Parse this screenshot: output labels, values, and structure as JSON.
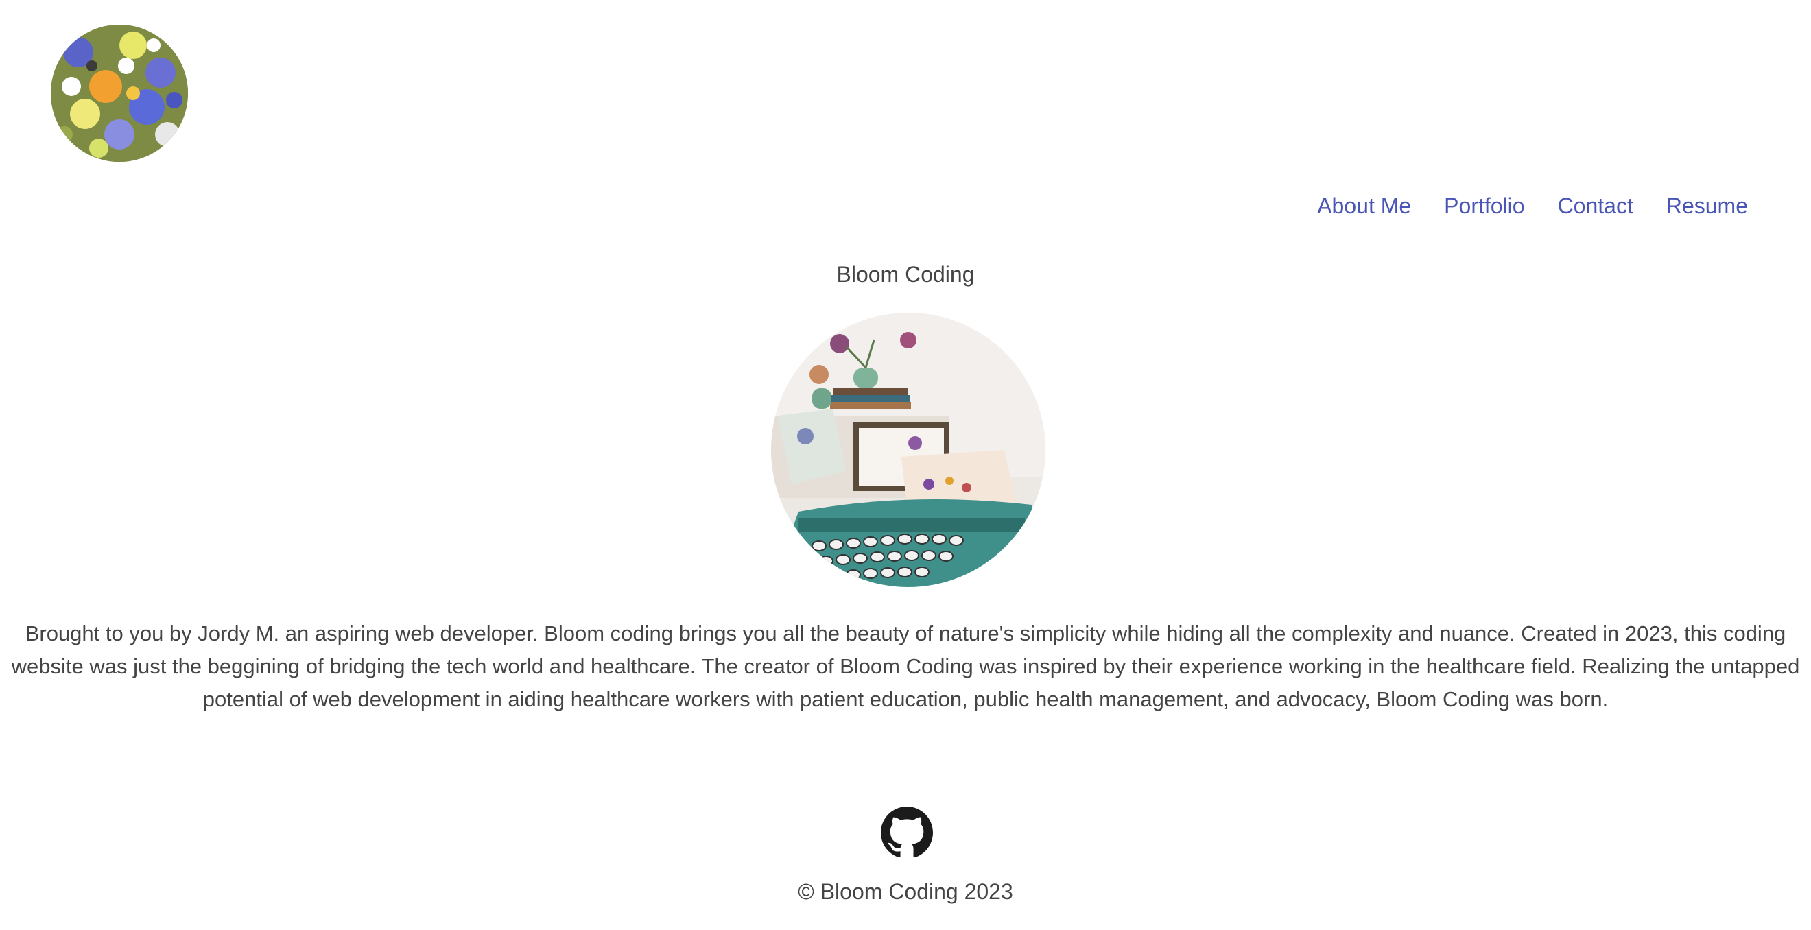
{
  "header": {
    "logo_icon": "flower-meadow-logo"
  },
  "nav": {
    "items": [
      {
        "label": "About Me"
      },
      {
        "label": "Portfolio"
      },
      {
        "label": "Contact"
      },
      {
        "label": "Resume"
      }
    ]
  },
  "main": {
    "title": "Bloom Coding",
    "hero_image": "typewriter-with-pressed-flowers",
    "bio": "Brought to you by Jordy M. an aspiring web developer. Bloom coding brings you all the beauty of nature's simplicity while hiding all the complexity and nuance. Created in 2023, this coding website was just the beggining of bridging the tech world and healthcare. The creator of Bloom Coding was inspired by their experience working in the healthcare field. Realizing the untapped potential of web development in aiding healthcare workers with patient education, public health management, and advocacy, Bloom Coding was born."
  },
  "footer": {
    "github_icon": "github-icon",
    "copyright": "© Bloom Coding 2023"
  },
  "colors": {
    "link": "#4a56b5",
    "text": "#444444",
    "background": "#ffffff"
  }
}
